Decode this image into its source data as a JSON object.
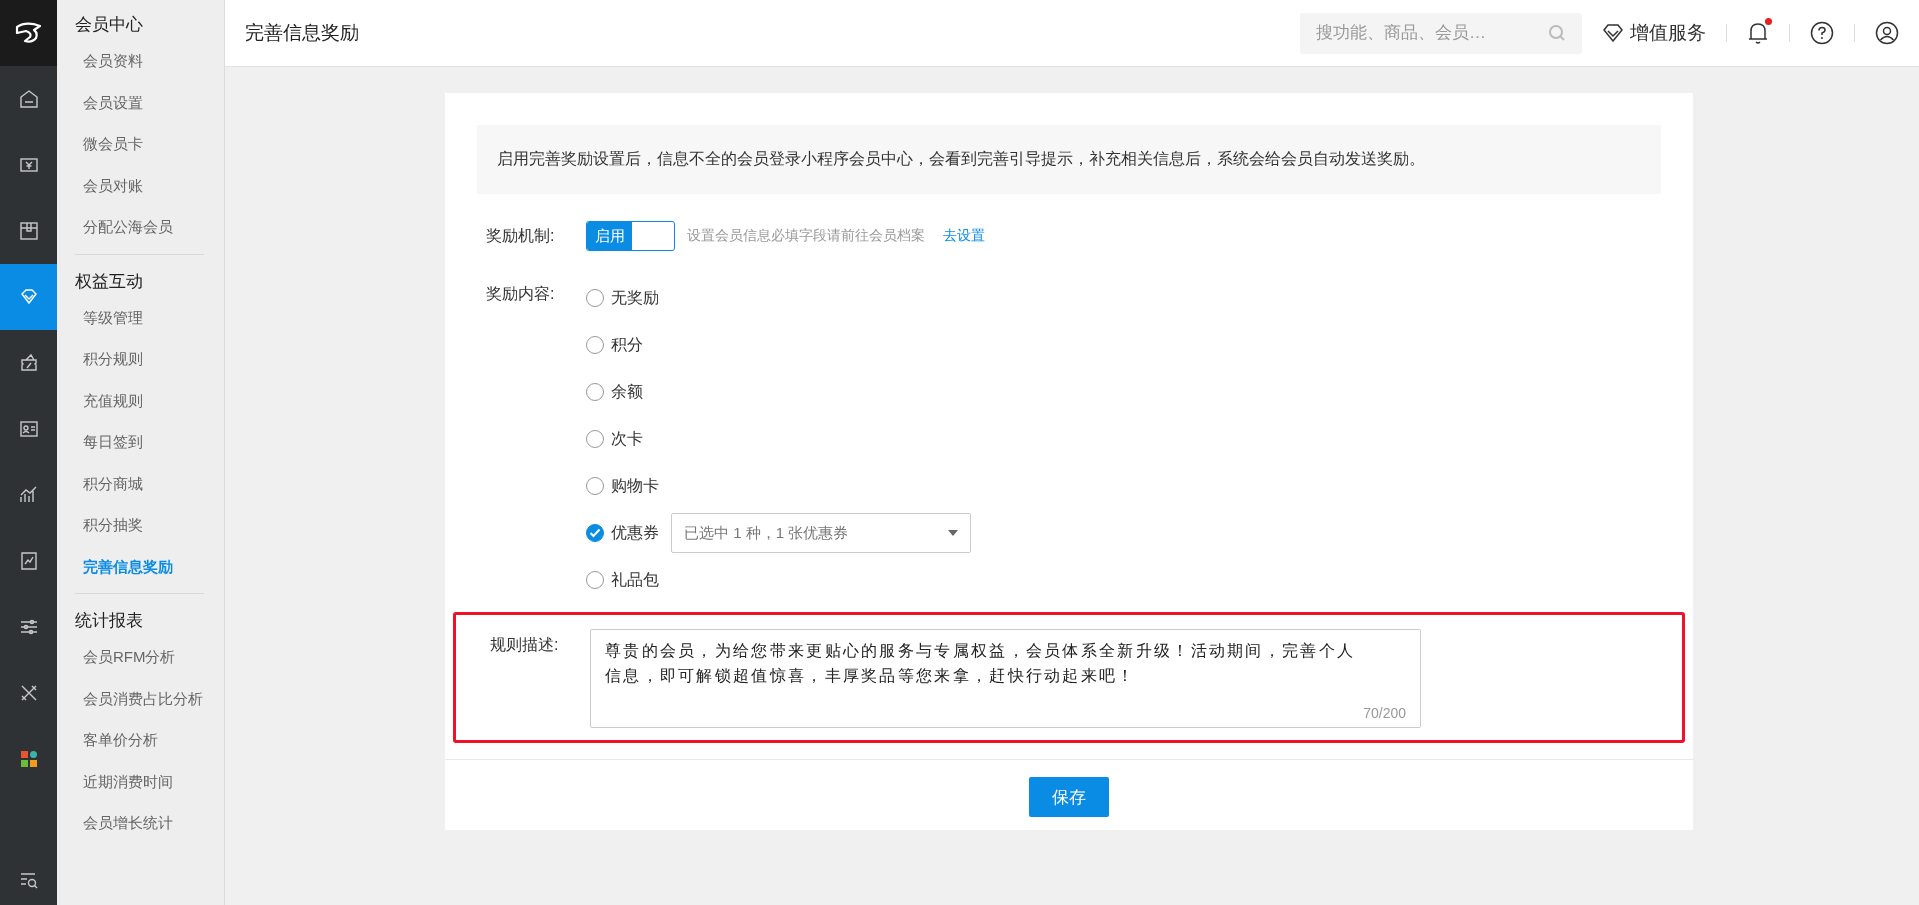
{
  "rail": [
    {
      "kind": "home",
      "selected": false
    },
    {
      "kind": "money",
      "selected": false
    },
    {
      "kind": "box",
      "selected": false
    },
    {
      "kind": "diamond",
      "selected": true
    },
    {
      "kind": "ticket",
      "selected": false
    },
    {
      "kind": "idcard",
      "selected": false
    },
    {
      "kind": "chart",
      "selected": false
    },
    {
      "kind": "report",
      "selected": false
    },
    {
      "kind": "sliders",
      "selected": false
    },
    {
      "kind": "tools",
      "selected": false
    },
    {
      "kind": "apps",
      "selected": false
    },
    {
      "kind": "search-list",
      "selected": false
    }
  ],
  "subnav": [
    {
      "title": "会员中心",
      "items": [
        {
          "label": "会员资料",
          "selected": false
        },
        {
          "label": "会员设置",
          "selected": false
        },
        {
          "label": "微会员卡",
          "selected": false
        },
        {
          "label": "会员对账",
          "selected": false
        },
        {
          "label": "分配公海会员",
          "selected": false
        }
      ]
    },
    {
      "title": "权益互动",
      "items": [
        {
          "label": "等级管理",
          "selected": false
        },
        {
          "label": "积分规则",
          "selected": false
        },
        {
          "label": "充值规则",
          "selected": false
        },
        {
          "label": "每日签到",
          "selected": false
        },
        {
          "label": "积分商城",
          "selected": false
        },
        {
          "label": "积分抽奖",
          "selected": false
        },
        {
          "label": "完善信息奖励",
          "selected": true
        }
      ]
    },
    {
      "title": "统计报表",
      "items": [
        {
          "label": "会员RFM分析",
          "selected": false
        },
        {
          "label": "会员消费占比分析",
          "selected": false
        },
        {
          "label": "客单价分析",
          "selected": false
        },
        {
          "label": "近期消费时间",
          "selected": false
        },
        {
          "label": "会员增长统计",
          "selected": false
        }
      ]
    }
  ],
  "header": {
    "title": "完善信息奖励",
    "search": {
      "placeholder": "搜功能、商品、会员…"
    },
    "value_service": "增值服务",
    "notification_dot": true
  },
  "notice": "启用完善奖励设置后，信息不全的会员登录小程序会员中心，会看到完善引导提示，补充相关信息后，系统会给会员自动发送奖励。",
  "mechanism": {
    "label": "奖励机制:",
    "toggle": {
      "label": "启用",
      "on": true
    },
    "hint": "设置会员信息必填字段请前往会员档案",
    "link": "去设置"
  },
  "content": {
    "label": "奖励内容:",
    "options": [
      {
        "label": "无奖励",
        "selected": false
      },
      {
        "label": "积分",
        "selected": false
      },
      {
        "label": "余额",
        "selected": false
      },
      {
        "label": "次卡",
        "selected": false
      },
      {
        "label": "购物卡",
        "selected": false
      },
      {
        "label": "优惠券",
        "selected": true,
        "dropdown": "已选中 1 种，1 张优惠券"
      },
      {
        "label": "礼品包",
        "selected": false
      }
    ]
  },
  "rule": {
    "label": "规则描述:",
    "highlighted": true,
    "value": "尊贵的会员，为给您带来更贴心的服务与专属权益，会员体系全新升级！活动期间，完善个人信息，即可解锁超值惊喜，丰厚奖品等您来拿，赶快行动起来吧！",
    "counter": "70/200"
  },
  "save_button": "保存"
}
